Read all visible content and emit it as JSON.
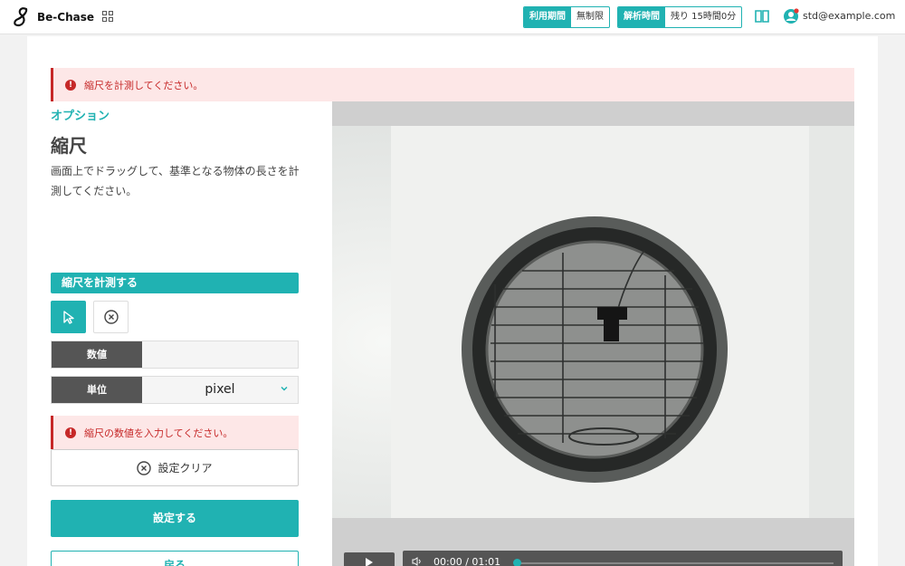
{
  "header": {
    "brand": "Be-Chase",
    "usage_period_label": "利用期間",
    "usage_period_value": "無制限",
    "analysis_time_label": "解析時間",
    "analysis_time_value": "残り 15時間0分",
    "user_email": "std@example.com"
  },
  "alerts": {
    "top": "縮尺を計測してください。",
    "value": "縮尺の数値を入力してください。"
  },
  "panel": {
    "option_label": "オプション",
    "title": "縮尺",
    "description": "画面上でドラッグして、基準となる物体の長さを計測してください。",
    "measure_section": "縮尺を計測する",
    "value_label": "数値",
    "value_input": "",
    "unit_label": "単位",
    "unit_selected": "pixel",
    "clear_label": "設定クリア",
    "submit_label": "設定する",
    "back_label": "戻る"
  },
  "player": {
    "time": "00:00 / 01:01",
    "progress": 0
  },
  "colors": {
    "accent": "#20b2b2",
    "error": "#c62828",
    "error_bg": "#fde7e7"
  },
  "icons": [
    "logo-icon",
    "apps-grid-icon",
    "book-icon",
    "user-icon",
    "alert-icon",
    "pointer-icon",
    "cancel-circle-icon",
    "chevron-down-icon",
    "play-icon",
    "volume-icon"
  ]
}
